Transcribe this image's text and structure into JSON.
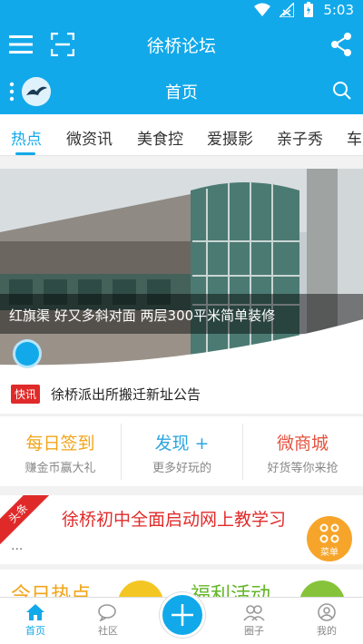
{
  "status_bar": {
    "time": "5:03",
    "icons": [
      "wifi-icon",
      "signal-icon",
      "battery-icon"
    ]
  },
  "top_bar": {
    "title": "徐桥论坛",
    "icons": [
      "menu-icon",
      "scan-icon",
      "share-icon"
    ]
  },
  "section_bar": {
    "title": "首页",
    "icons": [
      "more-dots-icon",
      "bird-avatar",
      "search-icon"
    ]
  },
  "tabs": [
    {
      "label": "热点",
      "active": true
    },
    {
      "label": "微资讯",
      "active": false
    },
    {
      "label": "美食控",
      "active": false
    },
    {
      "label": "爱摄影",
      "active": false
    },
    {
      "label": "亲子秀",
      "active": false
    },
    {
      "label": "车友",
      "active": false
    }
  ],
  "banner": {
    "caption": "红旗渠 好又多斜对面 两层300平米简单装修"
  },
  "news": {
    "badge": "快讯",
    "text": "徐桥派出所搬迁新址公告"
  },
  "quick_links": [
    {
      "title": "每日签到",
      "subtitle": "赚金币赢大礼",
      "color": "#f0a51a"
    },
    {
      "title": "发现 +",
      "subtitle": "更多好玩的",
      "color": "#2ba7e0"
    },
    {
      "title": "微商城",
      "subtitle": "好货等你来抢",
      "color": "#e4533f"
    }
  ],
  "headline": {
    "ribbon": "头条",
    "text": "徐桥初中全面启动网上教学习",
    "more": "..."
  },
  "menu_fab": {
    "label": "菜单"
  },
  "peek_section": {
    "left_title": "今日热点",
    "right_title": "福利活动"
  },
  "bottom_nav": [
    {
      "label": "首页",
      "icon": "home-icon",
      "active": true
    },
    {
      "label": "社区",
      "icon": "community-icon",
      "active": false
    },
    {
      "label": "",
      "icon": "plus-icon",
      "active": false
    },
    {
      "label": "圈子",
      "icon": "circle-icon",
      "active": false
    },
    {
      "label": "我的",
      "icon": "profile-icon",
      "active": false
    }
  ],
  "colors": {
    "accent": "#12a9ea",
    "alert": "#e02a2a"
  }
}
